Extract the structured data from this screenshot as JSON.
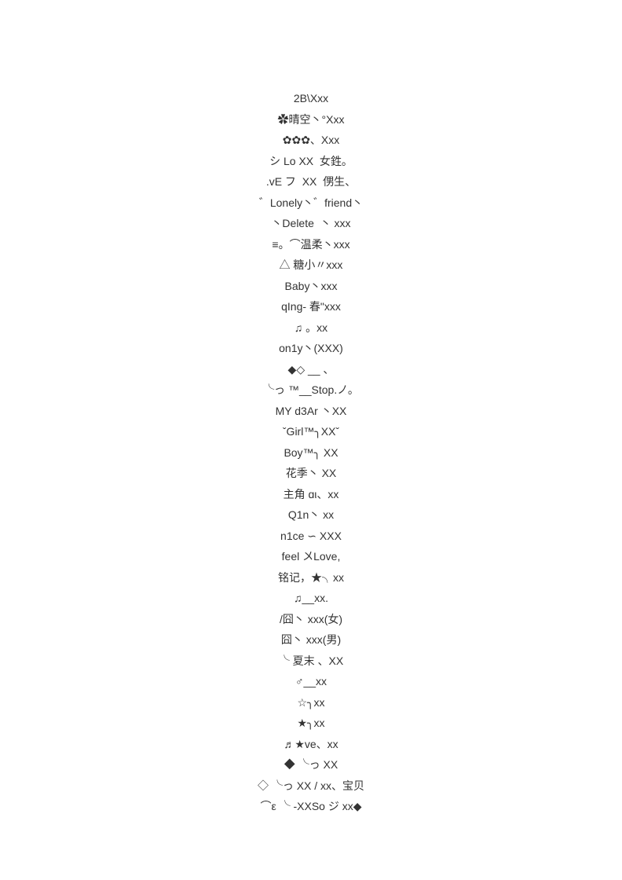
{
  "lines": [
    "2B\\Xxx",
    "✿晴空丶°Xxx",
    "✿✿✿、Xxx",
    "シ Lo XX  女鉎。",
    ".vE フ  XX  侽生、",
    "゛Lonely丶゛friend丶",
    "丶Delete  丶 xxx",
    "≡。⌒温柔丶xxx",
    "△ 糖小〃xxx",
    "Baby丶xxx",
    "qIng- 春\"xxx",
    "♫ 。xx",
    "on1y丶(XXX)",
    "◆◇ __ 、",
    "╰っ ™__Stоp.ノ。",
    "MY d3Ar 丶XX",
    "ˇGirl™╮XXˇ",
    "Boy™╮ XX",
    "花季丶 XX",
    "主角 ɑι、xx",
    "Q1n丶 xx",
    "n1ce ∽ XXX",
    "feel 〤Love,",
    "铭记，★╮xx",
    "♫__xx.",
    "/囧丶 xxx(女)",
    "囧丶 xxx(男)",
    "╰ 夏末 、XX",
    "♂__xx",
    "☆╮xx",
    "★╮xx",
    "♬★ve、xx",
    "◆ ╰っ XX",
    "◇ ╰っ XX / xx、宝贝",
    "⌒ε ╰ -XXSo ジ xx◆"
  ]
}
